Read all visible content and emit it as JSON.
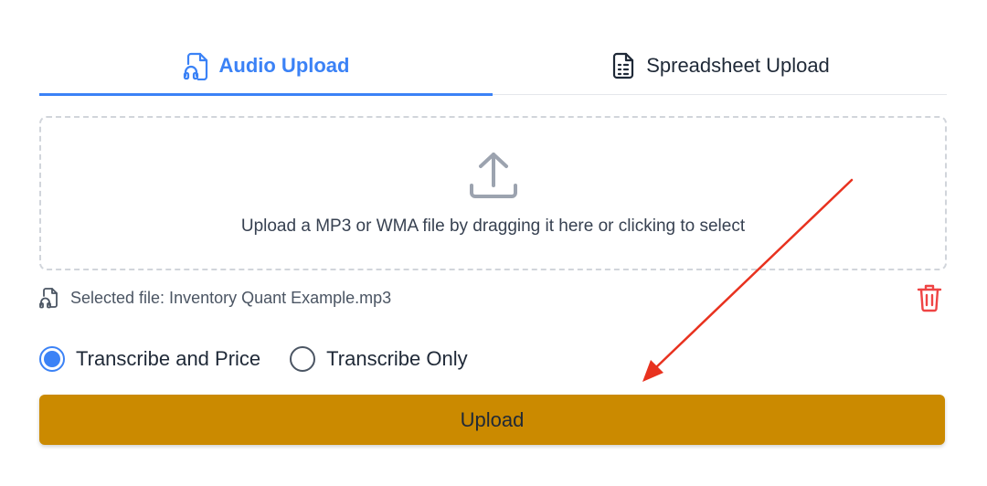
{
  "tabs": [
    {
      "label": "Audio Upload",
      "icon": "headphones-file-icon",
      "active": true
    },
    {
      "label": "Spreadsheet Upload",
      "icon": "spreadsheet-file-icon",
      "active": false
    }
  ],
  "dropzone": {
    "icon": "upload-icon",
    "hint": "Upload a MP3 or WMA file by dragging it here or clicking to select"
  },
  "selected_file": {
    "icon": "audio-file-icon",
    "label": "Selected file: Inventory Quant Example.mp3",
    "delete_icon": "trash-icon"
  },
  "mode_options": [
    {
      "label": "Transcribe and Price",
      "checked": true
    },
    {
      "label": "Transcribe Only",
      "checked": false
    }
  ],
  "upload_button": {
    "label": "Upload"
  },
  "colors": {
    "accent": "#3b82f6",
    "button": "#cb8a00",
    "danger": "#ef4444",
    "annotation_arrow": "#e8321f"
  }
}
